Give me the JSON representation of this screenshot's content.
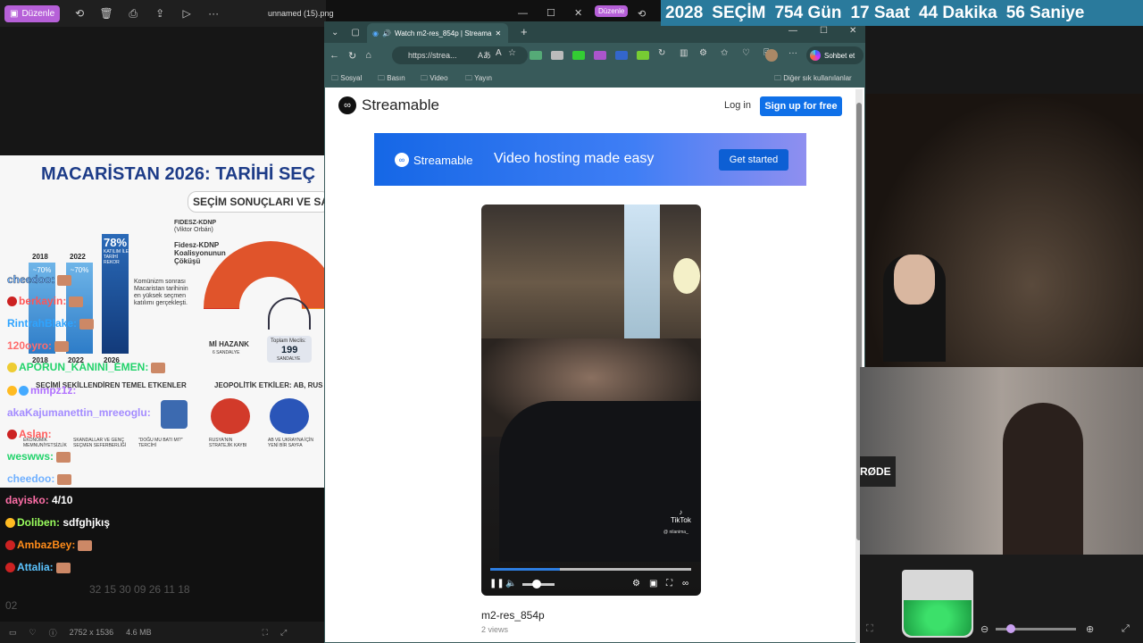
{
  "viewer": {
    "edit_label": "Düzenle",
    "file_name": "unnamed (15).png",
    "status_dims": "2752 x 1536",
    "status_size": "4.6 MB"
  },
  "browser": {
    "edit_label": "Düzenle",
    "tab_title": "Watch m2-res_854p | Streama",
    "url": "https://strea...",
    "chat_button": "Sohbet et",
    "bookmarks": [
      "Sosyal",
      "Basın",
      "Video",
      "Yayın"
    ],
    "other_bookmarks": "Diğer sık kullanılanlar"
  },
  "page": {
    "logo": "Streamable",
    "login": "Log in",
    "signup": "Sign up for free",
    "banner_logo": "Streamable",
    "banner_text": "Video hosting made easy",
    "banner_cta": "Get started",
    "video_title": "m2-res_854p",
    "video_views": "2 views",
    "watermark": "TikTok",
    "watermark_user": "@ nilanima_"
  },
  "countdown": {
    "year": "2028",
    "label": "SEÇİM",
    "days": "754 Gün",
    "hours": "17 Saat",
    "minutes": "44 Dakika",
    "seconds": "56 Saniye"
  },
  "infographic": {
    "title": "MACARİSTAN 2026: TARİHİ SEÇ",
    "subtitle": "SEÇİM SONUÇLARI VE SAY",
    "years": [
      "2018",
      "2022",
      "2026"
    ],
    "pct_2018": "~70%",
    "pct_2022": "~70%",
    "pct_2026": "78%",
    "record": "KATILIM İLE TARİHİ REKOR",
    "fidesz1": "FIDESZ-KDNP",
    "fidesz_sub": "(Viktor Orbán)",
    "fidesz2": "Fidesz-KDNP Koalisyonunun Çöküşü",
    "turnout_note": "Komünizm sonrası Macaristan tarihinin en yüksek seçmen katılımı gerçekleşti.",
    "mi_hazank": "Mİ HAZANK",
    "mi_seats": "6 SANDALYE",
    "total_label": "Toplam Meclis:",
    "total_seats": "199",
    "total_unit": "SANDALYE",
    "factors": "SEÇİMİ ŞEKİLLENDİREN TEMEL ETKENLER",
    "geo": "JEOPOLİTİK ETKİLER: AB, RUS",
    "col1": "EKONOMİK MEMNUNİYETSİZLİK",
    "col2": "SKANDALLAR VE GENÇ SEÇMEN SEFERBERLİĞİ",
    "col3": "\"DOĞU MU BATI MI?\" TERCİHİ",
    "col4": "RUSYA'NIN STRATEJİK KAYBI",
    "col5": "AB VE UKRAYNA İÇİN YENİ BİR SAYFA"
  },
  "chat": [
    {
      "name": "cheedoo:",
      "color": "#6fb0ff"
    },
    {
      "name": "berkayin:",
      "color": "#ff5555"
    },
    {
      "name": "RintrahBlake:",
      "color": "#2fa4ff"
    },
    {
      "name": "120oyro:",
      "color": "#ff6b6b"
    },
    {
      "name": "APORUN_KANINI_EMEN:",
      "color": "#22d36b"
    },
    {
      "name": "mmpz1z:",
      "color": "#b070ff"
    },
    {
      "name": "akaKajumanettin_mreeoglu:",
      "color": "#a48cff"
    },
    {
      "name": "Aslan:",
      "color": "#ff5c5c"
    },
    {
      "name": "weswws:",
      "color": "#22d36b"
    },
    {
      "name": "cheedoo:",
      "color": "#6fb0ff"
    }
  ],
  "chat_bottom": [
    {
      "name": "dayisko:",
      "msg": "4/10",
      "color": "#ff6fa8"
    },
    {
      "name": "Doliben:",
      "msg": "sdfghjkış",
      "color": "#9bff5e"
    },
    {
      "name": "AmbazBey:",
      "msg": "",
      "color": "#ff8c1a"
    },
    {
      "name": "Attalia:",
      "msg": "",
      "color": "#5cc4ff"
    },
    {
      "name": "",
      "msg": "32 15 30 09 26 11 18",
      "color": "#666"
    },
    {
      "name": "",
      "msg": "02",
      "color": "#666"
    }
  ],
  "right": {
    "rode": "RØDE"
  }
}
